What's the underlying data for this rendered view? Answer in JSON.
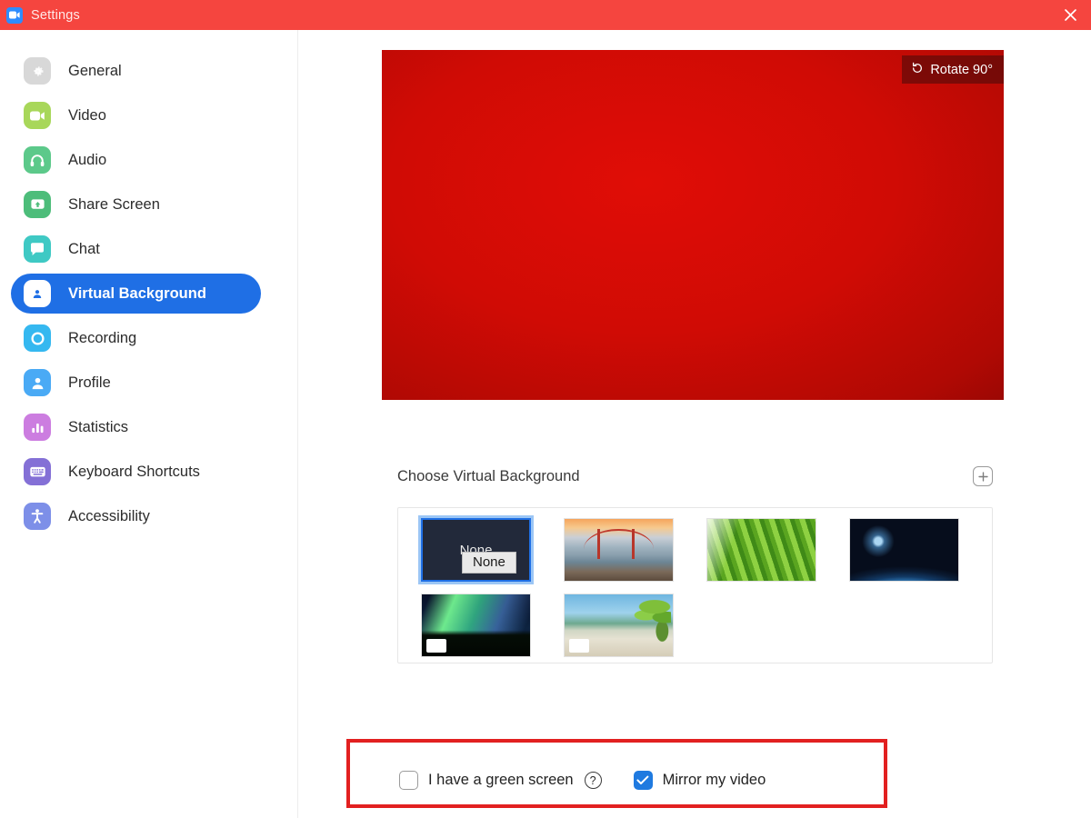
{
  "titlebar": {
    "title": "Settings",
    "app_icon": "zoom-camera-icon",
    "close_icon": "close-icon",
    "background_color": "#f5453f"
  },
  "sidebar": {
    "items": [
      {
        "label": "General",
        "icon": "gear-icon",
        "color": "#d8d8d8",
        "active": false
      },
      {
        "label": "Video",
        "icon": "video-icon",
        "color": "#a8d75a",
        "active": false
      },
      {
        "label": "Audio",
        "icon": "headphones-icon",
        "color": "#5cc98a",
        "active": false
      },
      {
        "label": "Share Screen",
        "icon": "share-up-icon",
        "color": "#4dbd7a",
        "active": false
      },
      {
        "label": "Chat",
        "icon": "chat-icon",
        "color": "#3fc9c4",
        "active": false
      },
      {
        "label": "Virtual Background",
        "icon": "person-card-icon",
        "color": "#ffffff",
        "active": true
      },
      {
        "label": "Recording",
        "icon": "record-icon",
        "color": "#35b8f0",
        "active": false
      },
      {
        "label": "Profile",
        "icon": "person-icon",
        "color": "#4aaaf5",
        "active": false
      },
      {
        "label": "Statistics",
        "icon": "bar-chart-icon",
        "color": "#cc7de0",
        "active": false
      },
      {
        "label": "Keyboard Shortcuts",
        "icon": "keyboard-icon",
        "color": "#8470d6",
        "active": false
      },
      {
        "label": "Accessibility",
        "icon": "accessibility-icon",
        "color": "#7d8fe8",
        "active": false
      }
    ],
    "active_color": "#1f6fe5"
  },
  "main": {
    "preview": {
      "rotate_label": "Rotate 90°",
      "rotate_icon": "rotate-ccw-icon",
      "background_color": "#d00b05"
    },
    "choose": {
      "title": "Choose Virtual Background",
      "add_icon": "plus-icon"
    },
    "backgrounds": [
      {
        "label": "None",
        "art": "none",
        "selected": true,
        "is_video": false
      },
      {
        "label": "Golden Gate Bridge",
        "art": "bridge",
        "selected": false,
        "is_video": false
      },
      {
        "label": "Grass",
        "art": "grass",
        "selected": false,
        "is_video": false
      },
      {
        "label": "Earth from space",
        "art": "earth",
        "selected": false,
        "is_video": false
      },
      {
        "label": "Aurora",
        "art": "aurora",
        "selected": false,
        "is_video": true
      },
      {
        "label": "Beach",
        "art": "beach",
        "selected": false,
        "is_video": true
      }
    ],
    "tooltip": {
      "text": "None"
    },
    "options": {
      "green_screen": {
        "label": "I have a green screen",
        "checked": false,
        "help_icon": "question-mark-icon",
        "help_glyph": "?"
      },
      "mirror_video": {
        "label": "Mirror my video",
        "checked": true
      }
    },
    "highlight_color": "#e22020"
  }
}
